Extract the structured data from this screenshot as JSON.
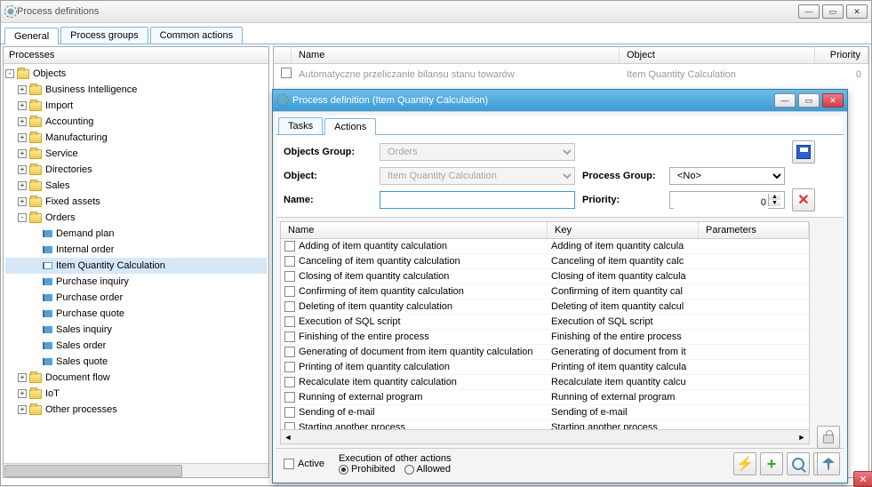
{
  "mainWindow": {
    "title": "Process definitions",
    "tabs": [
      "General",
      "Process groups",
      "Common actions"
    ],
    "activeTab": 0,
    "leftHeader": "Processes",
    "tree": {
      "root": "Objects",
      "folders": [
        "Business Intelligence",
        "Import",
        "Accounting",
        "Manufacturing",
        "Service",
        "Directories",
        "Sales",
        "Fixed assets"
      ],
      "expandedFolder": "Orders",
      "orderItems": [
        "Demand plan",
        "Internal order",
        "Item Quantity Calculation",
        "Purchase inquiry",
        "Purchase order",
        "Purchase quote",
        "Sales inquiry",
        "Sales order",
        "Sales quote"
      ],
      "selectedItem": "Item Quantity Calculation",
      "trailFolders": [
        "Document flow",
        "IoT",
        "Other processes"
      ]
    },
    "grid": {
      "cols": [
        "Name",
        "Object",
        "Priority"
      ],
      "row": {
        "name": "Automatyczne przeliczanie bilansu stanu towarów",
        "object": "Item Quantity Calculation",
        "priority": "0"
      }
    }
  },
  "modal": {
    "title": "Process definition (Item Quantity Calculation)",
    "tabs": [
      "Tasks",
      "Actions"
    ],
    "activeTab": 1,
    "form": {
      "objectsGroupLabel": "Objects Group:",
      "objectsGroupValue": "Orders",
      "objectLabel": "Object:",
      "objectValue": "Item Quantity Calculation",
      "nameLabel": "Name:",
      "nameValue": "",
      "processGroupLabel": "Process Group:",
      "processGroupValue": "<No>",
      "priorityLabel": "Priority:",
      "priorityValue": "0"
    },
    "actionGrid": {
      "cols": [
        "Name",
        "Key",
        "Parameters"
      ],
      "rows": [
        {
          "name": "Adding of item quantity calculation",
          "key": "Adding of item quantity calcula"
        },
        {
          "name": "Canceling of item quantity calculation",
          "key": "Canceling of item quantity calc"
        },
        {
          "name": "Closing of item quantity calculation",
          "key": "Closing of item quantity calcula"
        },
        {
          "name": "Confirming of item quantity calculation",
          "key": "Confirming of item quantity cal"
        },
        {
          "name": "Deleting of item quantity calculation",
          "key": "Deleting of item quantity calcul"
        },
        {
          "name": "Execution of SQL script",
          "key": "Execution of SQL script"
        },
        {
          "name": "Finishing of the entire process",
          "key": "Finishing of the entire process"
        },
        {
          "name": "Generating of document from item quantity calculation",
          "key": "Generating of document from it"
        },
        {
          "name": "Printing of item quantity calculation",
          "key": "Printing of item quantity calcula"
        },
        {
          "name": "Recalculate item quantity calculation",
          "key": "Recalculate item quantity calcu"
        },
        {
          "name": "Running of external program",
          "key": "Running of external program"
        },
        {
          "name": "Sending of e-mail",
          "key": "Sending of e-mail"
        },
        {
          "name": "Starting another process",
          "key": "Starting another process"
        }
      ]
    },
    "bottom": {
      "activeLabel": "Active",
      "execLabel": "Execution of other actions",
      "prohibited": "Prohibited",
      "allowed": "Allowed"
    }
  }
}
